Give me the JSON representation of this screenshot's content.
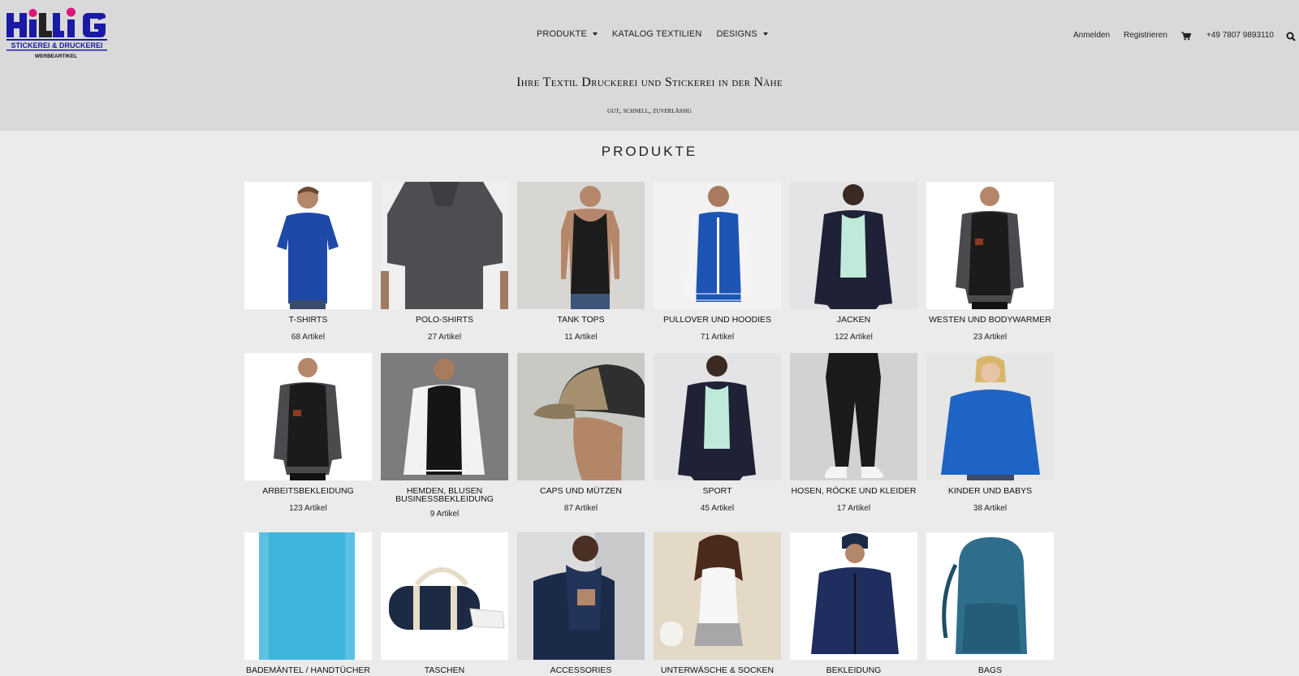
{
  "logo": {
    "text": "HiLLiG",
    "subtitle": "STICKEREI & DRUCKEREI",
    "subsubtitle": "WERBEARTIKEL"
  },
  "nav": {
    "items": [
      {
        "label": "PRODUKTE",
        "has_dropdown": true
      },
      {
        "label": "KATALOG TEXTILIEN",
        "has_dropdown": false
      },
      {
        "label": "DESIGNS",
        "has_dropdown": true
      }
    ]
  },
  "userbar": {
    "login": "Anmelden",
    "register": "Registrieren",
    "cart_icon": "cart-icon",
    "phone": "+49 7807 9893110",
    "search_icon": "search-icon"
  },
  "hero": {
    "headline": "Ihre Textil Druckerei und Stickerei in der Nähe",
    "tagline": "gut, schnell, zuverlässig"
  },
  "products": {
    "title": "PRODUKTE",
    "items": [
      {
        "name": "T-SHIRTS",
        "count": "68 Artikel"
      },
      {
        "name": "POLO-SHIRTS",
        "count": "27 Artikel"
      },
      {
        "name": "TANK TOPS",
        "count": "11 Artikel"
      },
      {
        "name": "PULLOVER UND HOODIES",
        "count": "71 Artikel"
      },
      {
        "name": "JACKEN",
        "count": "122 Artikel"
      },
      {
        "name": "WESTEN UND BODYWARMER",
        "count": "23 Artikel"
      },
      {
        "name": "ARBEITSBEKLEIDUNG",
        "count": "123 Artikel"
      },
      {
        "name": "HEMDEN, BLUSEN BUSINESSBEKLEIDUNG",
        "count": "9 Artikel"
      },
      {
        "name": "CAPS UND MÜTZEN",
        "count": "87 Artikel"
      },
      {
        "name": "SPORT",
        "count": "45 Artikel"
      },
      {
        "name": "HOSEN, RÖCKE UND KLEIDER",
        "count": "17 Artikel"
      },
      {
        "name": "KINDER UND BABYS",
        "count": "38 Artikel"
      },
      {
        "name": "BADEMÄNTEL / HANDTÜCHER",
        "count": ""
      },
      {
        "name": "TASCHEN",
        "count": ""
      },
      {
        "name": "ACCESSORIES",
        "count": ""
      },
      {
        "name": "UNTERWÄSCHE & SOCKEN",
        "count": ""
      },
      {
        "name": "BEKLEIDUNG",
        "count": ""
      },
      {
        "name": "BAGS",
        "count": ""
      }
    ]
  },
  "colors": {
    "header_bg": "#d9d9d9",
    "page_bg": "#ebebeb",
    "logo_blue": "#1a1aa6",
    "logo_pink": "#e0157a"
  }
}
